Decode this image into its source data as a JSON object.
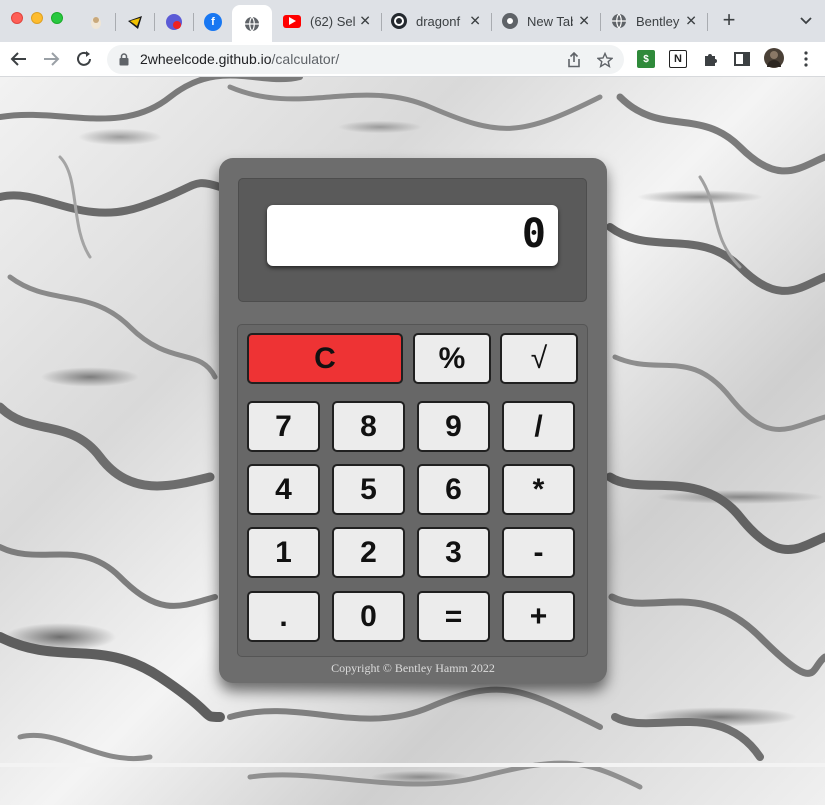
{
  "browser": {
    "tabs": [
      {
        "title": "(62) Sel",
        "favicon": "youtube-icon",
        "color": "#ff0000"
      },
      {
        "title": "dragonf",
        "favicon": "github-icon",
        "color": "#24292f"
      },
      {
        "title": "New Tab",
        "favicon": "chrome-icon",
        "color": "#5f6368"
      },
      {
        "title": "Bentley",
        "favicon": "globe-icon",
        "color": "#5f6368"
      }
    ],
    "url_host": "2wheelcode.github.io",
    "url_path": "/calculator/"
  },
  "calculator": {
    "display": "0",
    "keys": {
      "clear": "C",
      "percent": "%",
      "sqrt": "√",
      "seven": "7",
      "eight": "8",
      "nine": "9",
      "divide": "/",
      "four": "4",
      "five": "5",
      "six": "6",
      "multiply": "*",
      "one": "1",
      "two": "2",
      "three": "3",
      "minus": "-",
      "dot": ".",
      "zero": "0",
      "equals": "=",
      "plus": "+"
    },
    "copyright": "Copyright © Bentley Hamm 2022"
  },
  "colors": {
    "clear_key": "#ee3334",
    "body": "#6d6d6d"
  }
}
